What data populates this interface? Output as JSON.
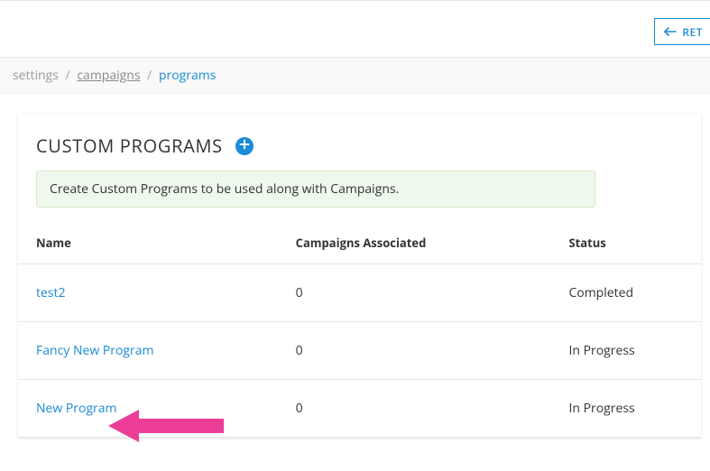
{
  "topbar": {
    "return_label": "RET"
  },
  "breadcrumb": {
    "items": [
      {
        "label": "settings",
        "link": false
      },
      {
        "label": "campaigns",
        "link": true
      },
      {
        "label": "programs",
        "link": false,
        "current": true
      }
    ],
    "sep": "/"
  },
  "card": {
    "title": "CUSTOM PROGRAMS",
    "info_text": "Create Custom Programs to be used along with Campaigns."
  },
  "table": {
    "columns": {
      "name": "Name",
      "campaigns": "Campaigns Associated",
      "status": "Status"
    },
    "rows": [
      {
        "name": "test2",
        "campaigns": "0",
        "status": "Completed"
      },
      {
        "name": "Fancy New Program",
        "campaigns": "0",
        "status": "In Progress"
      },
      {
        "name": "New Program",
        "campaigns": "0",
        "status": "In Progress"
      }
    ]
  }
}
